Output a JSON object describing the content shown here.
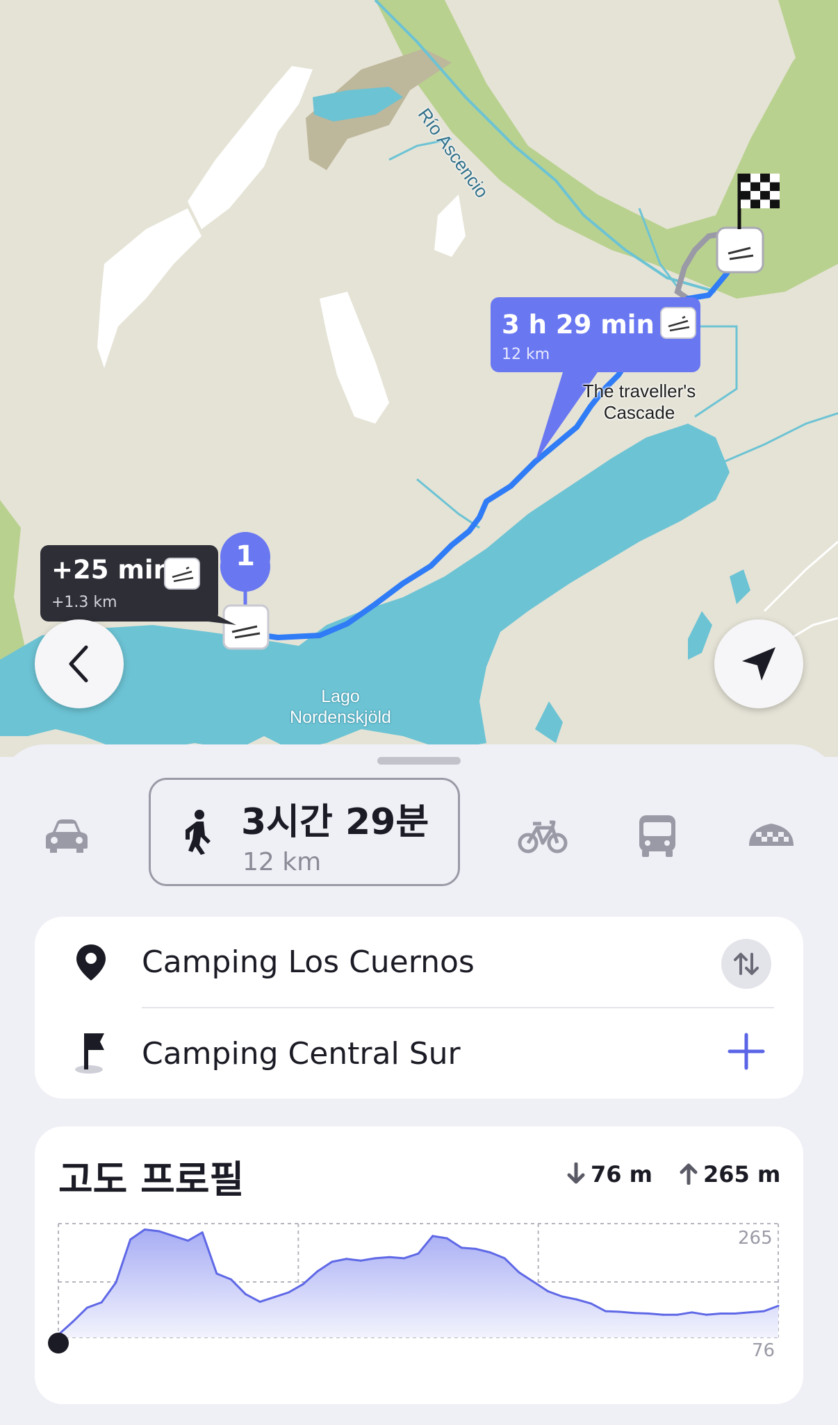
{
  "map": {
    "river_label": "Río Ascencio",
    "poi_label_line1": "The traveller's",
    "poi_label_line2": "Cascade",
    "lake_label_line1": "Lago",
    "lake_label_line2": "Nordenskjöld",
    "waypoint_number": "1",
    "alt_route_callout": {
      "time": "+25 min",
      "distance": "+1.3 km",
      "icon": "windy-icon"
    },
    "main_route_callout": {
      "time": "3 h 29 min",
      "distance": "12 km",
      "icon": "windy-icon"
    },
    "colors": {
      "land": "#e5e3d6",
      "forest": "#b7d190",
      "water": "#6cc3d4",
      "route": "#2f7cf6",
      "accent": "#6977f1"
    }
  },
  "transport": {
    "modes": [
      "car-icon",
      "walk-icon",
      "bike-icon",
      "bus-icon",
      "taxi-icon"
    ],
    "selected": {
      "mode": "walk-icon",
      "duration": "3시간 29분",
      "distance": "12 km"
    }
  },
  "route": {
    "from": "Camping Los Cuernos",
    "to": "Camping Central Sur"
  },
  "elevation": {
    "title": "고도 프로필",
    "descent": "76 m",
    "ascent": "265 m",
    "max_label": "265",
    "min_label": "76"
  },
  "chart_data": {
    "type": "area",
    "ylim": [
      76,
      265
    ],
    "x": [
      0,
      0.02,
      0.04,
      0.06,
      0.08,
      0.1,
      0.12,
      0.14,
      0.16,
      0.18,
      0.2,
      0.22,
      0.24,
      0.26,
      0.28,
      0.3,
      0.32,
      0.34,
      0.36,
      0.38,
      0.4,
      0.42,
      0.44,
      0.46,
      0.48,
      0.5,
      0.52,
      0.54,
      0.56,
      0.58,
      0.6,
      0.62,
      0.64,
      0.66,
      0.68,
      0.7,
      0.72,
      0.74,
      0.76,
      0.78,
      0.8,
      0.82,
      0.84,
      0.86,
      0.88,
      0.9,
      0.92,
      0.94,
      0.96,
      0.98,
      1
    ],
    "values": [
      76,
      98,
      122,
      131,
      165,
      238,
      255,
      252,
      244,
      236,
      250,
      180,
      170,
      145,
      132,
      140,
      148,
      162,
      184,
      200,
      205,
      202,
      206,
      208,
      206,
      214,
      244,
      240,
      224,
      222,
      216,
      206,
      182,
      166,
      150,
      141,
      136,
      129,
      116,
      115,
      113,
      112,
      110,
      110,
      114,
      110,
      112,
      112,
      114,
      116,
      125
    ],
    "series": [
      {
        "values": [
          76,
          98,
          122,
          131,
          165,
          238,
          255,
          252,
          244,
          236,
          250,
          180,
          170,
          145,
          132,
          140,
          148,
          162,
          184,
          200,
          205,
          202,
          206,
          208,
          206,
          214,
          244,
          240,
          224,
          222,
          216,
          206,
          182,
          166,
          150,
          141,
          136,
          129,
          116,
          115,
          113,
          112,
          110,
          110,
          114,
          110,
          112,
          112,
          114,
          116,
          125
        ]
      }
    ]
  }
}
